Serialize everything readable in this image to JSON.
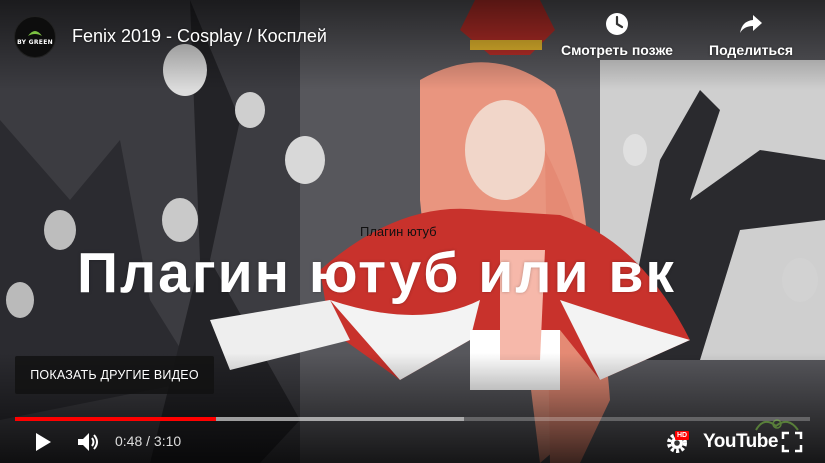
{
  "header": {
    "channel_avatar_text": "BY GREEN",
    "video_title": "Fenix 2019 - Cosplay / Косплей",
    "watch_later_label": "Смотреть позже",
    "share_label": "Поделиться"
  },
  "overlay": {
    "caption_small": "Плагин ютуб",
    "caption_big": "Плагин ютуб или вк",
    "more_videos_label": "ПОКАЗАТЬ ДРУГИЕ ВИДЕО"
  },
  "player": {
    "current_time": "0:48",
    "duration": "3:10",
    "time_display": "0:48 / 3:10",
    "played_fraction": 0.253,
    "buffered_fraction": 0.565,
    "hd_badge": "HD",
    "logo_text": "YouTube"
  },
  "colors": {
    "progress_played": "#ff0000",
    "accent": "#ff0000"
  },
  "icons": {
    "watch_later": "clock-icon",
    "share": "share-arrow-icon",
    "play": "play-icon",
    "volume": "volume-icon",
    "settings": "gear-icon",
    "fullscreen": "fullscreen-icon"
  }
}
